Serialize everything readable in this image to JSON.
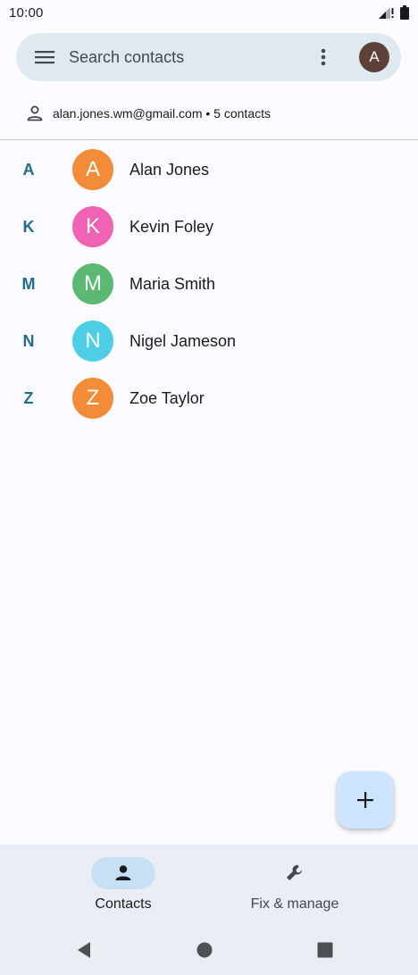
{
  "status_bar": {
    "time": "10:00"
  },
  "search": {
    "placeholder": "Search contacts",
    "avatar_letter": "A"
  },
  "account": {
    "summary": "alan.jones.wm@gmail.com • 5 contacts"
  },
  "contacts": [
    {
      "section": "A",
      "initial": "A",
      "name": "Alan Jones",
      "color": "#f28c38"
    },
    {
      "section": "K",
      "initial": "K",
      "name": "Kevin Foley",
      "color": "#f062b4"
    },
    {
      "section": "M",
      "initial": "M",
      "name": "Maria Smith",
      "color": "#5bb974"
    },
    {
      "section": "N",
      "initial": "N",
      "name": "Nigel Jameson",
      "color": "#4ecde6"
    },
    {
      "section": "Z",
      "initial": "Z",
      "name": "Zoe Taylor",
      "color": "#f28c38"
    }
  ],
  "bottom_nav": [
    {
      "label": "Contacts",
      "icon": "person-icon",
      "active": true
    },
    {
      "label": "Fix & manage",
      "icon": "wrench-icon",
      "active": false
    }
  ],
  "icons": {
    "menu": "menu-icon",
    "more": "more-vert-icon",
    "account": "person-outline-icon",
    "fab": "plus-icon",
    "back": "back-triangle-icon",
    "home": "home-circle-icon",
    "recents": "recents-square-icon",
    "signal": "signal-icon",
    "battery": "battery-icon"
  },
  "colors": {
    "accent": "#1f6e8c",
    "search_bg": "#e1e9f0",
    "fab_bg": "#cde5ff",
    "nav_active": "#c8e0f4",
    "avatar_top": "#5d4037"
  }
}
